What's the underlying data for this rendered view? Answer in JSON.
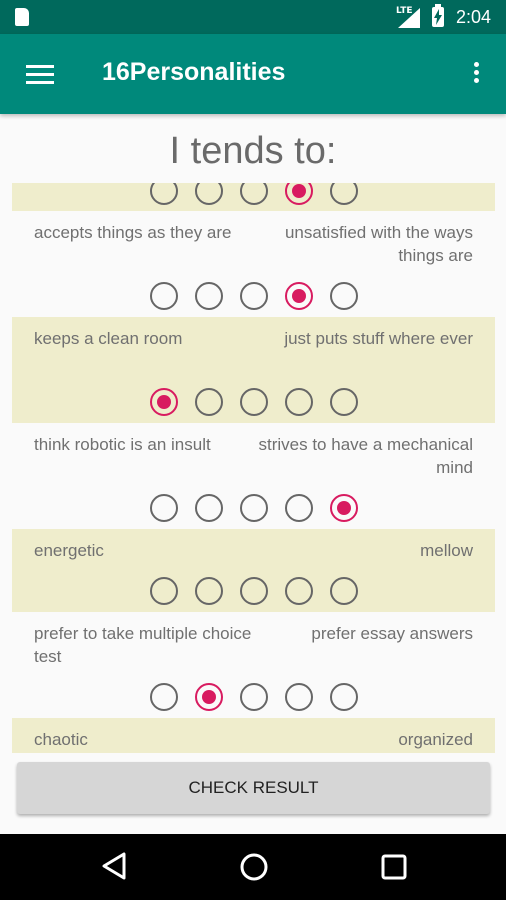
{
  "status_bar": {
    "network": "LTE",
    "time": "2:04"
  },
  "app_bar": {
    "title": "16Personalities"
  },
  "heading": "I tends to:",
  "items": [
    {
      "left": "",
      "right": "",
      "selected": 4
    },
    {
      "left": "accepts things as they are",
      "right": "unsatisfied with the ways things are",
      "selected": 4
    },
    {
      "left": "keeps a clean room",
      "right": "just puts stuff where ever",
      "selected": 1
    },
    {
      "left": "think robotic is an insult",
      "right": "strives to have a mechanical mind",
      "selected": 5
    },
    {
      "left": "energetic",
      "right": "mellow",
      "selected": 0
    },
    {
      "left": "prefer to take multiple choice test",
      "right": "prefer essay answers",
      "selected": 2
    },
    {
      "left": "chaotic",
      "right": "organized",
      "selected": 0
    }
  ],
  "check_button": "CHECK RESULT",
  "colors": {
    "status_bar": "#00695c",
    "app_bar": "#00897b",
    "accent": "#d81b60",
    "row_alt": "#efedcc"
  }
}
